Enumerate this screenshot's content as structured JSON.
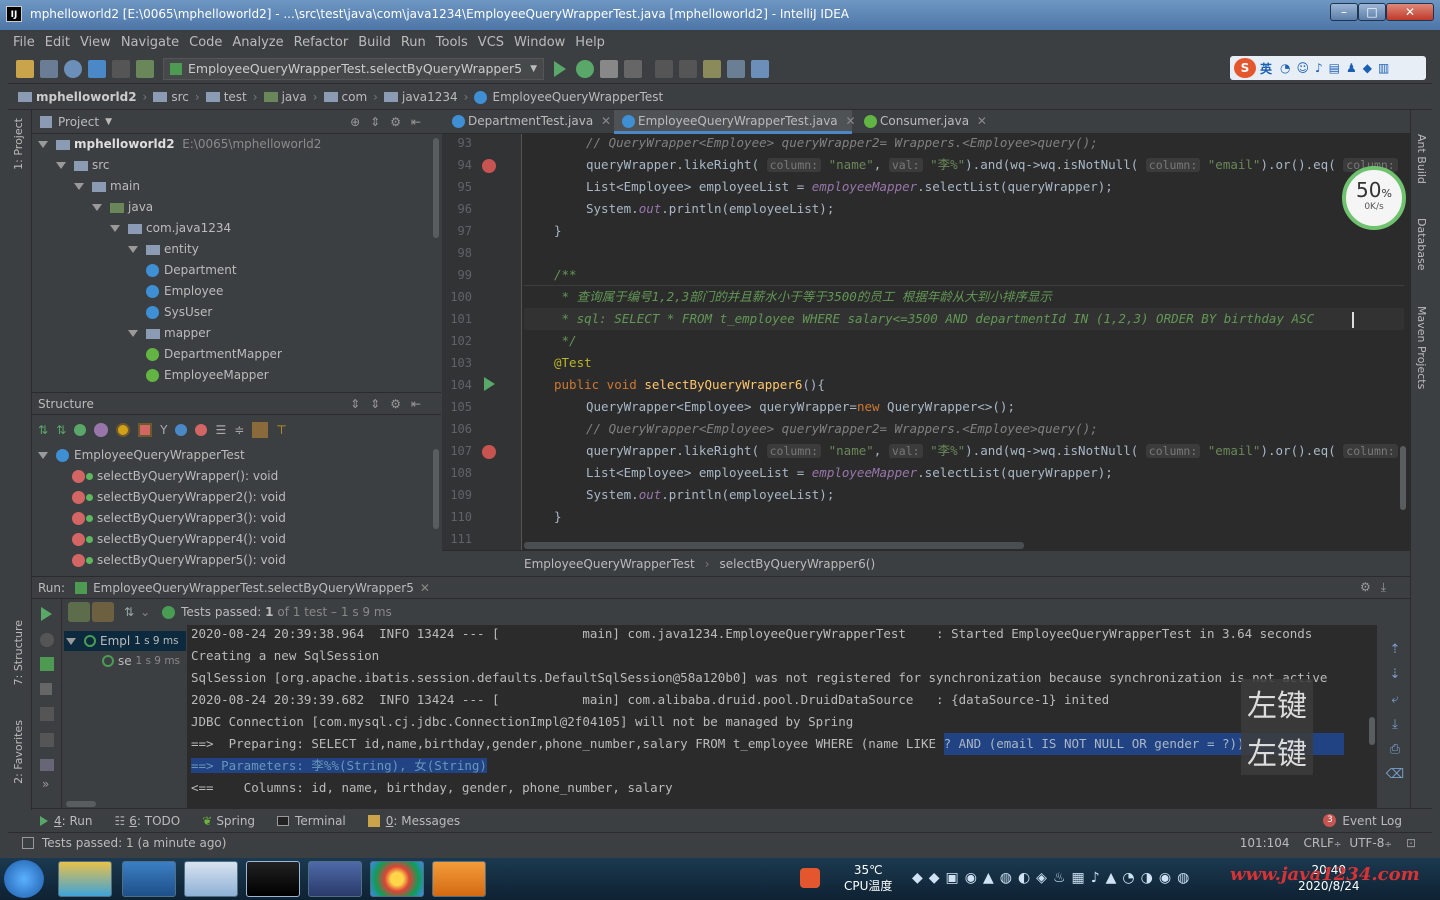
{
  "window": {
    "title": "mphelloworld2 [E:\\0065\\mphelloworld2] - ...\\src\\test\\java\\com\\java1234\\EmployeeQueryWrapperTest.java [mphelloworld2] - IntelliJ IDEA",
    "logo": "IJ"
  },
  "menu": [
    "File",
    "Edit",
    "View",
    "Navigate",
    "Code",
    "Analyze",
    "Refactor",
    "Build",
    "Run",
    "Tools",
    "VCS",
    "Window",
    "Help"
  ],
  "toolbar": {
    "run_config": "EmployeeQueryWrapperTest.selectByQueryWrapper5",
    "ime": "英"
  },
  "navbar": [
    "mphelloworld2",
    "src",
    "test",
    "java",
    "com",
    "java1234",
    "EmployeeQueryWrapperTest"
  ],
  "project": {
    "title": "Project",
    "root": "mphelloworld2",
    "root_path": "E:\\0065\\mphelloworld2",
    "tree": [
      {
        "label": "src",
        "depth": 1
      },
      {
        "label": "main",
        "depth": 2
      },
      {
        "label": "java",
        "depth": 3
      },
      {
        "label": "com.java1234",
        "depth": 4
      },
      {
        "label": "entity",
        "depth": 5
      },
      {
        "label": "Department",
        "depth": 6,
        "kind": "class"
      },
      {
        "label": "Employee",
        "depth": 6,
        "kind": "class"
      },
      {
        "label": "SysUser",
        "depth": 6,
        "kind": "class"
      },
      {
        "label": "mapper",
        "depth": 5
      },
      {
        "label": "DepartmentMapper",
        "depth": 6,
        "kind": "interface"
      },
      {
        "label": "EmployeeMapper",
        "depth": 6,
        "kind": "interface"
      }
    ]
  },
  "structure": {
    "title": "Structure",
    "root": "EmployeeQueryWrapperTest",
    "methods": [
      "selectByQueryWrapper(): void",
      "selectByQueryWrapper2(): void",
      "selectByQueryWrapper3(): void",
      "selectByQueryWrapper4(): void",
      "selectByQueryWrapper5(): void"
    ]
  },
  "tabs": [
    {
      "label": "DepartmentTest.java",
      "active": false
    },
    {
      "label": "EmployeeQueryWrapperTest.java",
      "active": true
    },
    {
      "label": "Consumer.java",
      "active": false
    }
  ],
  "editor": {
    "line_numbers": [
      "93",
      "94",
      "95",
      "96",
      "97",
      "98",
      "99",
      "100",
      "101",
      "102",
      "103",
      "104",
      "105",
      "106",
      "107",
      "108",
      "109",
      "110",
      "111"
    ],
    "lines": {
      "l93a": "// QueryWrapper<Employee> queryWrapper2= Wrappers.<Employee>query();",
      "l94a": "queryWrapper.likeRight(",
      "hint_column": "column:",
      "l94b": "\"name\"",
      "hint_val": "val:",
      "l94c": "\"李%\"",
      "l94d": ").and(wq->wq.isNotNull(",
      "l94e": "\"email\"",
      "l94f": ").or().eq(",
      "l95a": "List<Employee> employeeList = ",
      "l95b": "employeeMapper",
      "l95c": ".selectList(queryWrapper);",
      "l96a": "System.",
      "l96b": "out",
      "l96c": ".println(employeeList);",
      "l97": "}",
      "l99": "/**",
      "l100": " * 查询属于编号1,2,3部门的并且薪水小于等于3500的员工 根据年龄从大到小排序显示",
      "l101": " * sql: SELECT * FROM t_employee WHERE salary<=3500 AND departmentId IN (1,2,3) ORDER BY birthday ASC",
      "l102": " */",
      "l103": "@Test",
      "l104a": "public void ",
      "l104b": "selectByQueryWrapper6",
      "l104c": "(){",
      "l105a": "QueryWrapper<Employee> queryWrapper=",
      "l105b": "new ",
      "l105c": "QueryWrapper<>();",
      "l106": "// QueryWrapper<Employee> queryWrapper2= Wrappers.<Employee>query();",
      "l110": "}"
    },
    "breadcrumbs": [
      "EmployeeQueryWrapperTest",
      "selectByQueryWrapper6()"
    ],
    "memory": {
      "percent": "50",
      "unit": "%",
      "rate": "0K/s"
    }
  },
  "right_tools": [
    "Ant Build",
    "Database",
    "Maven Projects"
  ],
  "left_tools": [
    "1: Project",
    "7: Structure",
    "2: Favorites"
  ],
  "run": {
    "label": "Run:",
    "config": "EmployeeQueryWrapperTest.selectByQueryWrapper5",
    "tests_passed_prefix": "Tests passed:",
    "tests_passed_count": "1",
    "tests_passed_suffix": "of 1 test – 1 s 9 ms",
    "tree": [
      {
        "label": "Empl",
        "time": "1 s 9 ms"
      },
      {
        "label": "se",
        "time": "1 s 9 ms"
      }
    ],
    "output": [
      "2020-08-24 20:39:38.964  INFO 13424 --- [           main] com.java1234.EmployeeQueryWrapperTest    : Started EmployeeQueryWrapperTest in 3.64 seconds",
      "Creating a new SqlSession",
      "SqlSession [org.apache.ibatis.session.defaults.DefaultSqlSession@58a120b0] was not registered for synchronization because synchronization is not active",
      "2020-08-24 20:39:39.682  INFO 13424 --- [           main] com.alibaba.druid.pool.DruidDataSource   : {dataSource-1} inited",
      "JDBC Connection [com.mysql.cj.jdbc.ConnectionImpl@2f04105] will not be managed by Spring"
    ],
    "preparing_a": "==>  Preparing: SELECT id,name,birthday,gender,phone_number,salary FROM t_employee WHERE (name LIKE ",
    "preparing_b": "? AND (email IS NOT NULL OR gender = ?))",
    "parameters": "==> Parameters: 李%%(String), 女(String)",
    "columns": "<==    Columns: id, name, birthday, gender, phone_number, salary",
    "overlay": "左键"
  },
  "bottom_tools": [
    {
      "num": "4",
      "label": "Run"
    },
    {
      "num": "6",
      "label": "TODO"
    },
    {
      "num": "",
      "label": "Spring"
    },
    {
      "num": "",
      "label": "Terminal"
    },
    {
      "num": "0",
      "label": "Messages"
    }
  ],
  "event_log": {
    "count": "3",
    "label": "Event Log"
  },
  "status": {
    "message": "Tests passed: 1 (a minute ago)",
    "position": "101:104",
    "line_sep": "CRLF",
    "encoding": "UTF-8"
  },
  "taskbar": {
    "temp": "35℃",
    "temp_label": "CPU温度",
    "time": "20:40",
    "date": "2020/8/24",
    "watermark": "www.java1234.com"
  },
  "colors": {
    "editor_bg": "#2b2b2b",
    "panel_bg": "#3c3f41",
    "selection": "#214283",
    "accent": "#4a88c7"
  }
}
